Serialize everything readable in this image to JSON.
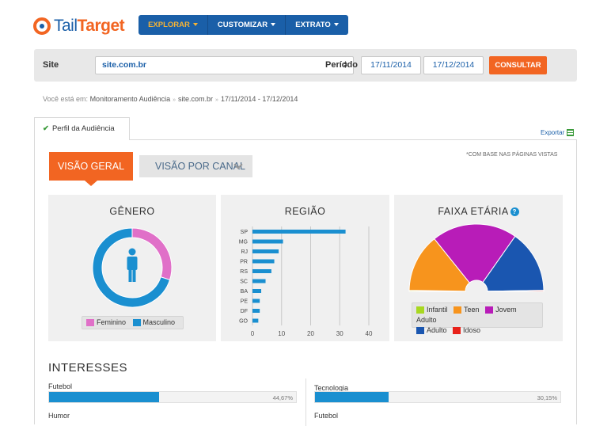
{
  "brand": {
    "name_part1": "Tail",
    "name_part2": "Target",
    "logo_icon": "target-logo-icon"
  },
  "nav": {
    "items": [
      {
        "label": "EXPLORAR",
        "active": true
      },
      {
        "label": "CUSTOMIZAR",
        "active": false
      },
      {
        "label": "EXTRATO",
        "active": false
      }
    ]
  },
  "filters": {
    "site_label": "Site",
    "site_value": "site.com.br",
    "periodo_label": "Período",
    "date_from": "17/11/2014",
    "date_to": "17/12/2014",
    "submit_label": "CONSULTAR"
  },
  "breadcrumb": {
    "prefix": "Você está em:",
    "items": [
      "Monitoramento Audiência",
      "site.com.br",
      "17/11/2014 - 17/12/2014"
    ]
  },
  "tabs": {
    "active_label": "Perfil da Audiência",
    "export_label": "Exportar"
  },
  "view_buttons": {
    "geral": "VISÃO GERAL",
    "canal": "VISÃO POR CANAL"
  },
  "base_note": "*COM BASE NAS PÁGINAS VISTAS",
  "colors": {
    "primary": "#1a5fa8",
    "accent": "#f26522",
    "bar": "#1a8fd0"
  },
  "genero": {
    "title": "GÊNERO",
    "legend": [
      {
        "label": "Feminino",
        "color": "#e070c8"
      },
      {
        "label": "Masculino",
        "color": "#1a8fd0"
      }
    ]
  },
  "regiao": {
    "title": "REGIÃO",
    "xticks": [
      "0",
      "10",
      "20",
      "30",
      "40"
    ]
  },
  "faixa": {
    "title": "FAIXA ETÁRIA",
    "help": "?",
    "legend": [
      {
        "label": "Infantil",
        "color": "#a8d820"
      },
      {
        "label": "Teen",
        "color": "#f7941d"
      },
      {
        "label": "Jovem Adulto",
        "color": "#b81cb8"
      },
      {
        "label": "Adulto",
        "color": "#1a56b0"
      },
      {
        "label": "Idoso",
        "color": "#e8221a"
      }
    ]
  },
  "interesses": {
    "title": "INTERESSES",
    "items": [
      {
        "label": "Futebol",
        "pct_text": "44,67%",
        "pct": 44.67
      },
      {
        "label": "Tecnologia",
        "pct_text": "30,15%",
        "pct": 30.15
      },
      {
        "label": "Humor"
      },
      {
        "label": "Futebol"
      }
    ]
  },
  "chart_data": [
    {
      "type": "pie",
      "title": "GÊNERO",
      "categories": [
        "Feminino",
        "Masculino"
      ],
      "values": [
        30,
        70
      ]
    },
    {
      "type": "bar",
      "title": "REGIÃO",
      "orientation": "horizontal",
      "categories": [
        "SP",
        "MG",
        "RJ",
        "PR",
        "RS",
        "SC",
        "BA",
        "PE",
        "DF",
        "GO"
      ],
      "values": [
        32,
        10.5,
        9,
        7.5,
        6.5,
        4.5,
        3,
        2.5,
        2.5,
        2
      ],
      "xlim": [
        0,
        40
      ],
      "grid": true
    },
    {
      "type": "pie",
      "title": "FAIXA ETÁRIA",
      "variant": "semi-donut",
      "categories": [
        "Infantil",
        "Teen",
        "Jovem Adulto",
        "Adulto",
        "Idoso"
      ],
      "values": [
        0.5,
        28,
        41,
        30,
        0.5
      ]
    }
  ]
}
